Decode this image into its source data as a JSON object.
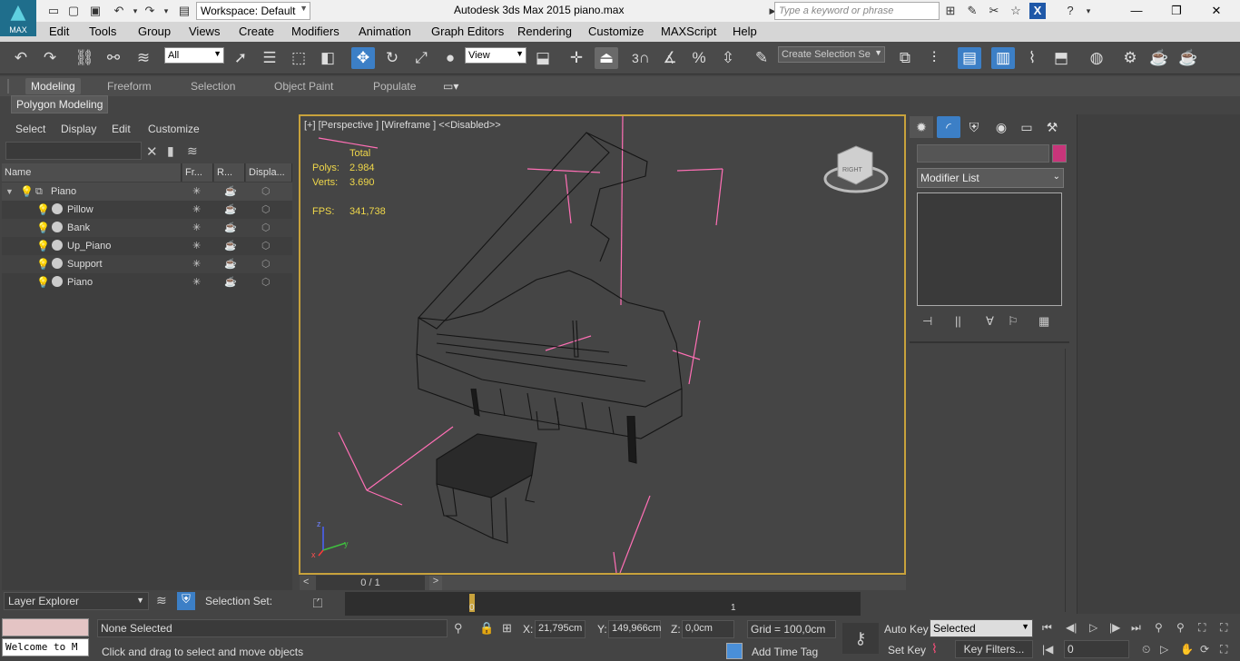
{
  "titlebar": {
    "logo_text": "MAX",
    "workspace": "Workspace: Default",
    "app_title": "Autodesk 3ds Max  2015     piano.max",
    "search_placeholder": "Type a keyword or phrase"
  },
  "menu": [
    "Edit",
    "Tools",
    "Group",
    "Views",
    "Create",
    "Modifiers",
    "Animation",
    "Graph Editors",
    "Rendering",
    "Customize",
    "MAXScript",
    "Help"
  ],
  "toolbar": {
    "filter": "All",
    "ref_coord": "View",
    "snap_3": "3",
    "selection_set_placeholder": "Create Selection Se"
  },
  "ribbon": {
    "tabs": [
      "Modeling",
      "Freeform",
      "Selection",
      "Object Paint",
      "Populate"
    ],
    "panel": "Polygon Modeling"
  },
  "scene_explorer": {
    "menu": [
      "Select",
      "Display",
      "Edit",
      "Customize"
    ],
    "headers": {
      "name": "Name",
      "frozen": "Fr...",
      "render": "R...",
      "display": "Displa..."
    },
    "parent": "Piano",
    "children": [
      "Pillow",
      "Bank",
      "Up_Piano",
      "Support",
      "Piano"
    ]
  },
  "viewport": {
    "label": "[+] [Perspective ] [Wireframe ]  <<Disabled>>",
    "stats_header": "Total",
    "polys_label": "Polys:",
    "polys": "2.984",
    "verts_label": "Verts:",
    "verts": "3.690",
    "fps_label": "FPS:",
    "fps": "341,738",
    "axis_x": "x",
    "axis_y": "y",
    "axis_z": "z",
    "cube_label": "RIGHT"
  },
  "timeline": {
    "frame": "0 / 1",
    "track_start": "0",
    "track_end": "1"
  },
  "command_panel": {
    "modifier_list": "Modifier List",
    "swatch_color": "#c8357a"
  },
  "layer": {
    "explorer": "Layer Explorer",
    "selection_set_label": "Selection Set:"
  },
  "status": {
    "maxscript": "Welcome to M",
    "selected": "None Selected",
    "prompt": "Click and drag to select and move objects",
    "x_label": "X:",
    "x": "21,795cm",
    "y_label": "Y:",
    "y": "149,966cm",
    "z_label": "Z:",
    "z": "0,0cm",
    "grid": "Grid = 100,0cm",
    "add_time_tag": "Add Time Tag",
    "auto_key": "Auto Key",
    "set_key": "Set Key",
    "key_mode": "Selected",
    "key_filters": "Key Filters...",
    "current_frame": "0"
  }
}
